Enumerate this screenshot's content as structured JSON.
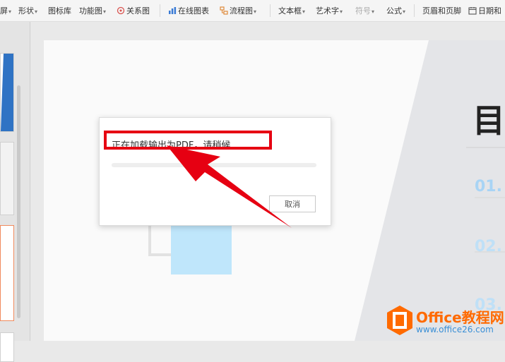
{
  "toolbar": {
    "items": [
      {
        "label": "屏",
        "caret": "▾"
      },
      {
        "label": "形状",
        "caret": "▾"
      },
      {
        "label": "图标库",
        "caret": ""
      },
      {
        "label": "功能图",
        "caret": "▾"
      },
      {
        "label": "关系图",
        "caret": ""
      },
      {
        "label": "在线图表",
        "caret": ""
      },
      {
        "label": "流程图",
        "caret": "▾"
      },
      {
        "label": "文本框",
        "caret": "▾"
      },
      {
        "label": "艺术字",
        "caret": "▾"
      },
      {
        "label": "符号",
        "caret": "▾"
      },
      {
        "label": "公式",
        "caret": "▾"
      },
      {
        "label": "页眉和页脚",
        "caret": ""
      },
      {
        "label": "日期和",
        "caret": ""
      }
    ]
  },
  "dialog": {
    "message": "正在加载输出为PDF，请稍候",
    "progress": 0,
    "cancel_label": "取消"
  },
  "slide": {
    "heading_char": "目",
    "numbers": [
      "01.",
      "02.",
      "03."
    ]
  },
  "watermark": {
    "title": "Office教程网",
    "url": "www.office26.com"
  },
  "colors": {
    "highlight": "#e60012",
    "accent_blue": "#a8d4f5",
    "watermark_orange": "#ff6a00"
  }
}
